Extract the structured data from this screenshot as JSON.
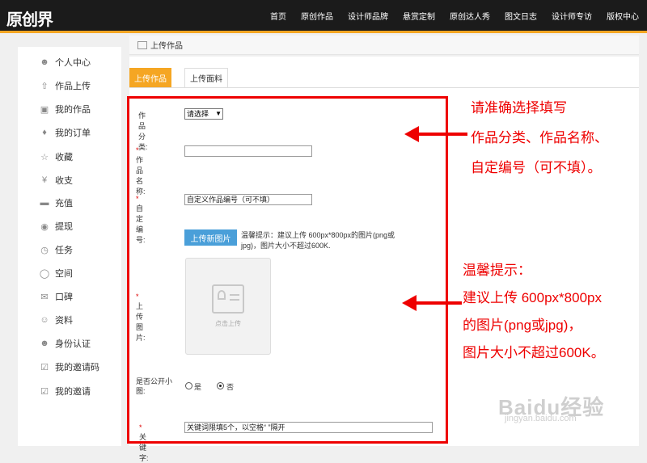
{
  "header": {
    "logo": "原创界",
    "nav": [
      "首页",
      "原创作品",
      "设计师品牌",
      "悬赏定制",
      "原创达人秀",
      "图文日志",
      "设计师专访",
      "版权中心"
    ]
  },
  "sidebar": {
    "items": [
      {
        "label": "个人中心",
        "icon": "person-icon"
      },
      {
        "label": "作品上传",
        "icon": "upload-icon"
      },
      {
        "label": "我的作品",
        "icon": "image-icon"
      },
      {
        "label": "我的订单",
        "icon": "handshake-icon"
      },
      {
        "label": "收藏",
        "icon": "star-icon"
      },
      {
        "label": "收支",
        "icon": "yen-icon"
      },
      {
        "label": "充值",
        "icon": "card-icon"
      },
      {
        "label": "提现",
        "icon": "money-bag-icon"
      },
      {
        "label": "任务",
        "icon": "clock-icon"
      },
      {
        "label": "空间",
        "icon": "space-icon"
      },
      {
        "label": "口碑",
        "icon": "comment-icon"
      },
      {
        "label": "资料",
        "icon": "profile-icon"
      },
      {
        "label": "身份认证",
        "icon": "id-icon"
      },
      {
        "label": "我的邀请码",
        "icon": "invite-code-icon"
      },
      {
        "label": "我的邀请",
        "icon": "invite-icon"
      }
    ]
  },
  "main": {
    "breadcrumb": "上传作品",
    "tabs": [
      "上传作品",
      "上传面料"
    ],
    "form": {
      "category_label": "作品分类:",
      "category_value": "请选择",
      "name_label": "作品名称:",
      "code_label": "自定编号:",
      "code_value": "自定义作品编号（可不填）",
      "upload_button": "上传新图片",
      "upload_hint": "温馨提示：建议上传 600px*800px的图片(png或jpg)，图片大小不超过600K.",
      "image_label": "上传图片:",
      "upload_placeholder": "点击上传",
      "public_label": "是否公开小图:",
      "radio_yes": "是",
      "radio_no": "否",
      "keyword_label": "关键字:",
      "keyword_value": "关键词限填5个，以空格“ ”隔开",
      "required_mark": "*"
    }
  },
  "annotations": {
    "top": [
      "请准确选择填写",
      "作品分类、作品名称、",
      "自定编号（可不填）。"
    ],
    "bottom": [
      "温馨提示：",
      "建议上传  600px*800px",
      "的图片(png或jpg)，",
      "图片大小不超过600K。"
    ]
  },
  "watermark": {
    "brand": "Baidu经验",
    "url": "jingyan.baidu.com"
  },
  "colors": {
    "accent": "#f5a623",
    "annotation_red": "#e00000",
    "button_blue": "#4a9fd9"
  }
}
